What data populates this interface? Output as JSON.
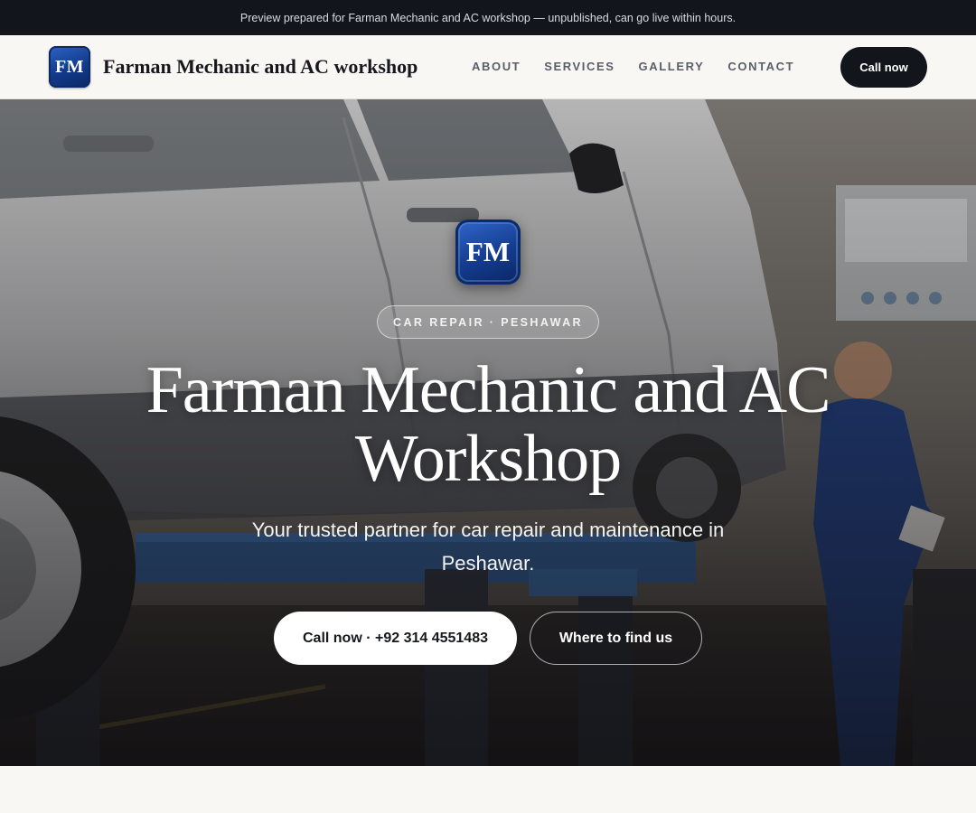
{
  "banner": {
    "text": "Preview prepared for Farman Mechanic and AC workshop — unpublished, can go live within hours."
  },
  "header": {
    "logo_text": "FM",
    "brand_name": "Farman Mechanic and AC workshop",
    "nav": [
      {
        "label": "ABOUT"
      },
      {
        "label": "SERVICES"
      },
      {
        "label": "GALLERY"
      },
      {
        "label": "CONTACT"
      }
    ],
    "cta_label": "Call now"
  },
  "hero": {
    "logo_text": "FM",
    "badge": "CAR REPAIR · PESHAWAR",
    "title_line1": "Farman Mechanic and AC",
    "title_line2": "Workshop",
    "subtitle": "Your trusted partner for car repair and maintenance in Peshawar.",
    "primary_button": "Call now · +92 314 4551483",
    "secondary_button": "Where to find us",
    "background_description_icon": "car-on-lift-photo"
  },
  "colors": {
    "topbar_bg": "#12151b",
    "page_bg": "#f8f7f3",
    "logo_blue": "#143c8e",
    "cta_dark": "#12151b"
  }
}
